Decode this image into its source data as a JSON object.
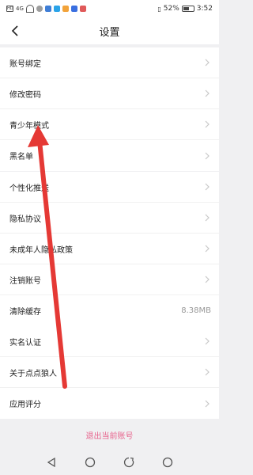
{
  "status_bar": {
    "carrier": "HD",
    "signal": "4G",
    "battery_percent": "52%",
    "time": "3:52"
  },
  "header": {
    "title": "设置"
  },
  "group1": [
    {
      "label": "账号绑定"
    },
    {
      "label": "修改密码"
    },
    {
      "label": "青少年模式"
    },
    {
      "label": "黑名单"
    }
  ],
  "group2": [
    {
      "label": "个性化推送"
    },
    {
      "label": "隐私协议"
    },
    {
      "label": "未成年人隐私政策"
    },
    {
      "label": "注销账号"
    },
    {
      "label": "清除缓存",
      "value": "8.38MB"
    }
  ],
  "group3": [
    {
      "label": "实名认证"
    },
    {
      "label": "关于点点狼人"
    },
    {
      "label": "应用评分"
    }
  ],
  "logout": {
    "label": "退出当前账号",
    "color": "#e7628c"
  },
  "annotation": {
    "arrow_color": "#e53935"
  }
}
